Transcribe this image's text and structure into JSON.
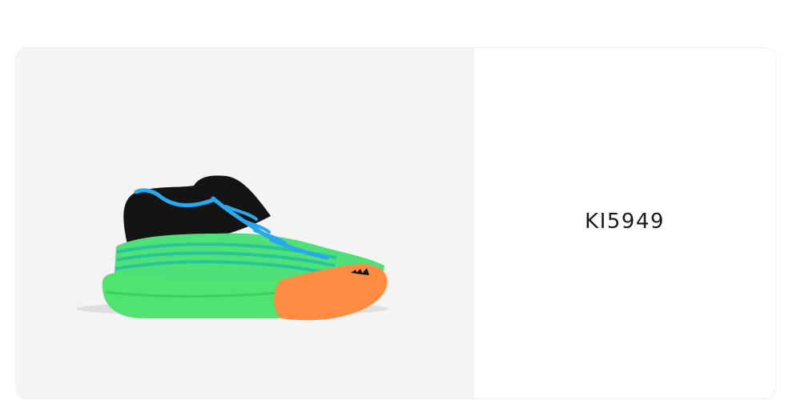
{
  "product": {
    "image_subject": "shoe-icon",
    "sku": "KI5949"
  },
  "colors": {
    "image_background": "#f4f4f5",
    "shoe_green": "#4fe07a",
    "shoe_teal": "#26c69a",
    "shoe_black": "#141414",
    "shoe_orange": "#ff8c42",
    "lace_blue": "#2aa8ee",
    "text": "#1a1a1a"
  }
}
